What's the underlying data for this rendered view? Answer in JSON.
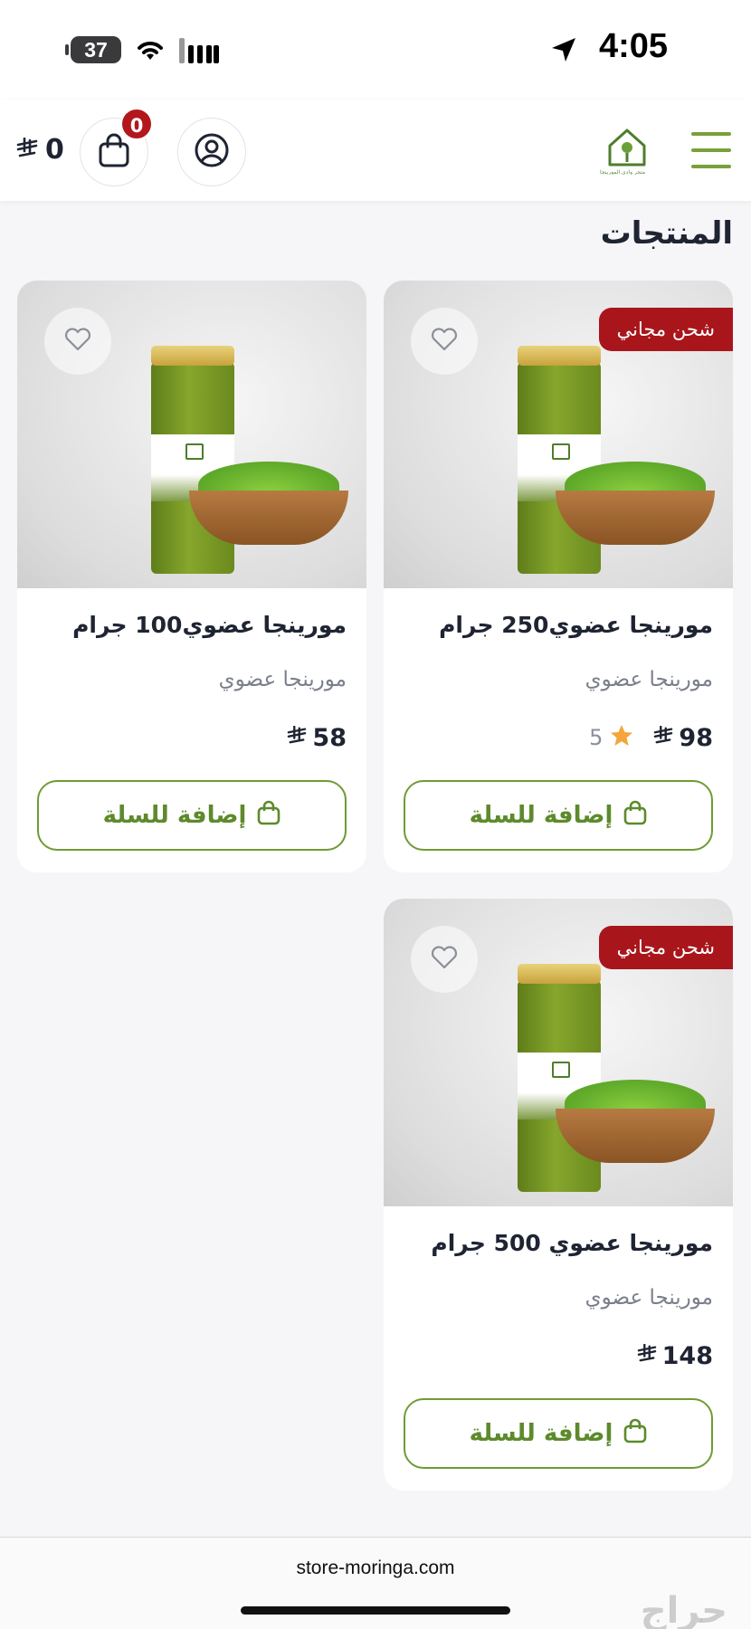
{
  "status_bar": {
    "time": "4:05",
    "battery": "37",
    "icons": [
      "wifi-icon",
      "signal-icon",
      "location-arrow-icon"
    ]
  },
  "header": {
    "cart_total": "0",
    "currency_symbol": "⃁",
    "cart_count": "0",
    "logo_text": "متجر وادي المورينجا",
    "icons": [
      "menu-icon",
      "cart-icon",
      "user-icon"
    ],
    "accent_color": "#7aa03a"
  },
  "page_title": "المنتجات",
  "products": [
    {
      "name": "مورينجا عضوي250 جرام",
      "category": "مورينجا عضوي",
      "price": "98",
      "rating": "5",
      "badge": "شحن مجاني",
      "add_to_cart": "إضافة للسلة"
    },
    {
      "name": "مورينجا عضوي100 جرام",
      "category": "مورينجا عضوي",
      "price": "58",
      "rating": "",
      "badge": "",
      "add_to_cart": "إضافة للسلة"
    },
    {
      "name": "مورينجا عضوي 500 جرام",
      "category": "مورينجا عضوي",
      "price": "148",
      "rating": "",
      "badge": "شحن مجاني",
      "add_to_cart": "إضافة للسلة"
    }
  ],
  "colors": {
    "badge_red": "#a8161c",
    "button_green": "#6f9b35",
    "star": "#f4a63b"
  },
  "footer": {
    "url": "store-moringa.com",
    "watermark": "حراج"
  }
}
